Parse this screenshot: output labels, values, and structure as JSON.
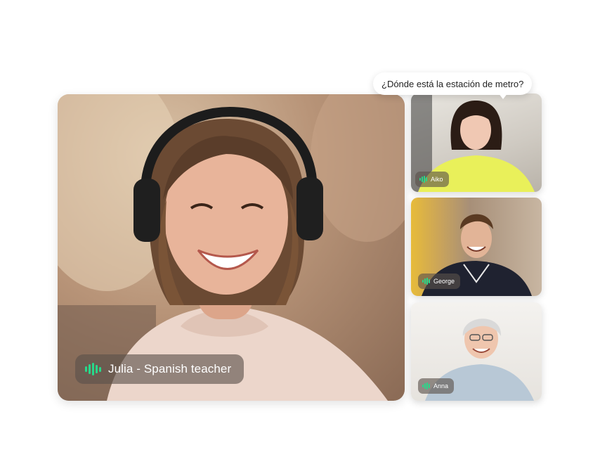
{
  "call": {
    "speech_bubble": "¿Dónde está la estación de metro?",
    "main_participant": {
      "name": "Julia - Spanish teacher",
      "speaking_icon": "audio-wave-icon"
    },
    "participants": [
      {
        "name": "Aiko",
        "speaking_icon": "audio-wave-icon"
      },
      {
        "name": "George",
        "speaking_icon": "audio-wave-icon"
      },
      {
        "name": "Anna",
        "speaking_icon": "audio-wave-icon"
      }
    ]
  },
  "colors": {
    "accent": "#28d88a",
    "badge_bg": "#5a504a",
    "bubble_bg": "#ffffff"
  }
}
